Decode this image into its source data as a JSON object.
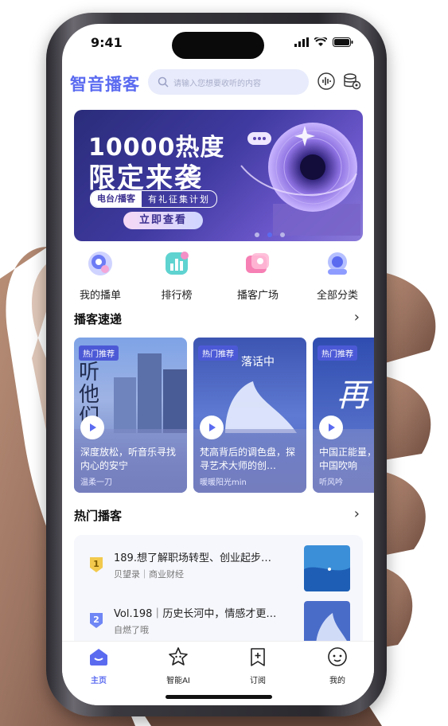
{
  "status": {
    "time": "9:41"
  },
  "header": {
    "logo": "智音播客",
    "search_placeholder": "请输入您想要收听的内容"
  },
  "banner": {
    "title_line1": "10000热度",
    "title_line2": "限定来袭",
    "tag_left": "电台/播客",
    "tag_right": "有礼征集计划",
    "button": "立即查看",
    "page_count": 3,
    "active_page": 2
  },
  "quick_links": [
    {
      "label": "我的播单",
      "icon": "playlist-icon"
    },
    {
      "label": "排行榜",
      "icon": "ranking-icon"
    },
    {
      "label": "播客广场",
      "icon": "podcast-plaza-icon"
    },
    {
      "label": "全部分类",
      "icon": "all-categories-icon"
    }
  ],
  "express": {
    "title": "播客速递",
    "cards": [
      {
        "tag": "热门推荐",
        "title": "深度放松，听音乐寻找内心的安宁",
        "author": "温柔一刀",
        "cover_text": "听他们"
      },
      {
        "tag": "热门推荐",
        "title": "梵高背后的调色盘，探寻艺术大师的创…",
        "author": "暖暖阳光min",
        "cover_text": "落话中"
      },
      {
        "tag": "热门推荐",
        "title": "中国正能量，新时代的中国吹响",
        "author": "听风吟",
        "cover_text": "再"
      }
    ]
  },
  "hot": {
    "title": "热门播客",
    "items": [
      {
        "rank": "1",
        "title": "189.想了解职场转型、创业起步…",
        "subtitle": "贝望录｜商业财经"
      },
      {
        "rank": "2",
        "title": "Vol.198｜历史长河中，情感才更…",
        "subtitle": "自燃了哦"
      }
    ]
  },
  "tabs": [
    {
      "label": "主页",
      "active": true,
      "icon": "home-icon"
    },
    {
      "label": "智能AI",
      "active": false,
      "icon": "ai-star-icon"
    },
    {
      "label": "订阅",
      "active": false,
      "icon": "subscribe-icon"
    },
    {
      "label": "我的",
      "active": false,
      "icon": "profile-icon"
    }
  ],
  "colors": {
    "accent": "#5b6bf0",
    "active_tab": "#5b6bf0",
    "rank1": "#f2c94c",
    "rank2": "#6f86f5"
  }
}
